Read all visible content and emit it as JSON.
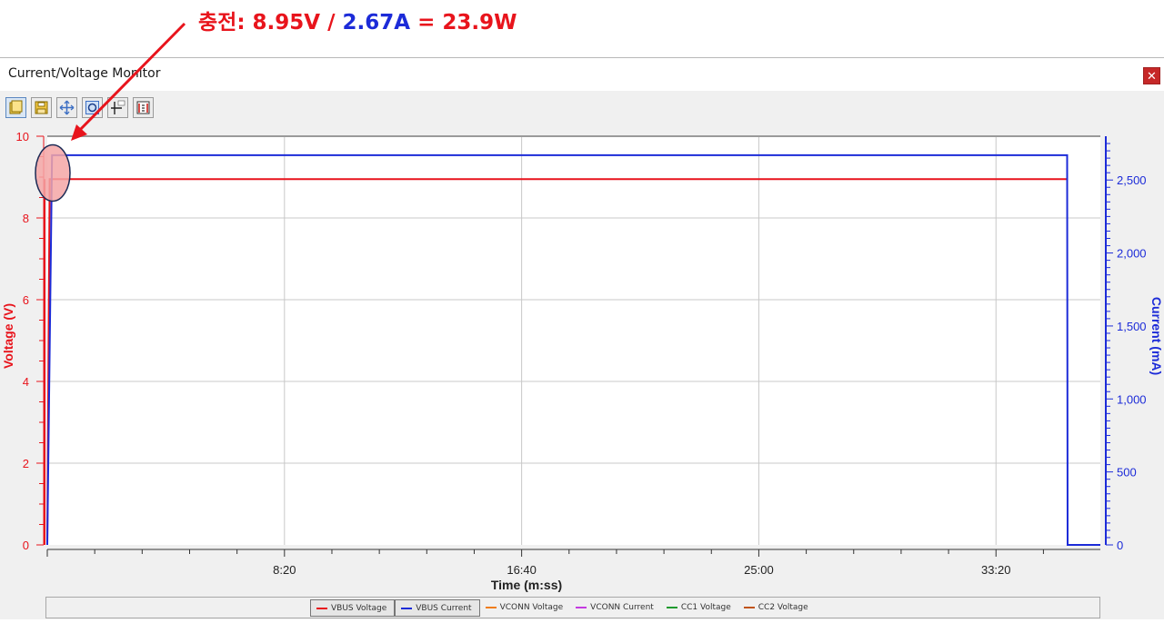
{
  "annotation": {
    "prefix": "충전: 8.95V",
    "separator": " / ",
    "current": "2.67A",
    "result": " = 23.9W"
  },
  "window": {
    "title": "Current/Voltage Monitor",
    "close_glyph": "✕"
  },
  "toolbar": {
    "buttons": [
      {
        "name": "open-icon"
      },
      {
        "name": "save-icon"
      },
      {
        "name": "zoom-fit-icon"
      },
      {
        "name": "zoom-region-icon"
      },
      {
        "name": "cursor-value-icon"
      },
      {
        "name": "settings-icon"
      }
    ]
  },
  "colors": {
    "voltage": "#e8141c",
    "current": "#1c2bd8",
    "grid": "#c8c8c8",
    "highlight_fill": "#f4a6a6",
    "highlight_stroke": "#1b2a55"
  },
  "chart_data": {
    "type": "line",
    "xlabel": "Time (m:ss)",
    "ylabel_left": "Voltage (V)",
    "ylabel_right": "Current (mA)",
    "x_ticks": [
      "8:20",
      "16:40",
      "25:00",
      "33:20"
    ],
    "y_left_ticks": [
      "0",
      "2",
      "4",
      "6",
      "8",
      "10"
    ],
    "y_right_ticks": [
      "0",
      "500",
      "1,000",
      "1,500",
      "2,000",
      "2,500"
    ],
    "x_range_seconds": [
      0,
      2220
    ],
    "y_left_range": [
      0,
      10
    ],
    "y_right_range": [
      0,
      2800
    ],
    "grid": true,
    "series": [
      {
        "name": "VBUS Voltage",
        "axis": "left",
        "values_desc": "steady",
        "x": [
          0,
          5,
          2150,
          2151
        ],
        "y": [
          0,
          8.95,
          8.95,
          8.95
        ]
      },
      {
        "name": "VBUS Current",
        "axis": "right",
        "x": [
          0,
          10,
          2150,
          2151,
          2220
        ],
        "y": [
          0,
          2670,
          2670,
          0,
          0
        ]
      }
    ]
  },
  "legend": {
    "items": [
      {
        "label": "VBUS Voltage",
        "color": "#e8141c",
        "selected": true
      },
      {
        "label": "VBUS Current",
        "color": "#1c2bd8",
        "selected": true
      },
      {
        "label": "VCONN Voltage",
        "color": "#f07d1a",
        "selected": false
      },
      {
        "label": "VCONN Current",
        "color": "#c43be0",
        "selected": false
      },
      {
        "label": "CC1 Voltage",
        "color": "#1f9a2e",
        "selected": false
      },
      {
        "label": "CC2 Voltage",
        "color": "#c0531a",
        "selected": false
      }
    ]
  }
}
